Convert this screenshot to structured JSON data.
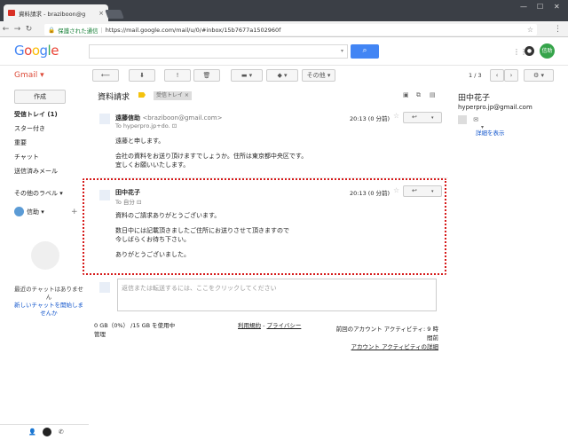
{
  "browser": {
    "tab_title": "資料請求 - braziboon@g",
    "address": {
      "secure_label": "保護された通信",
      "url": "https://mail.google.com/mail/u/0/#inbox/15b7677a1502960f"
    }
  },
  "header": {
    "logo": "Google",
    "avatar_text": "信助"
  },
  "toolbar": {
    "app_label": "Gmail ▾",
    "back_glyph": "⟵",
    "archive_glyph": "⬇",
    "spam_glyph": "!",
    "delete_glyph": "🗑",
    "folder_glyph": "▬ ▾",
    "label_glyph": "◆ ▾",
    "more_label": "その他 ▾",
    "pagination": "1 / 3",
    "settings_glyph": "⚙ ▾"
  },
  "sidebar": {
    "compose_label": "作成",
    "items": [
      {
        "label": "受信トレイ (1)",
        "bold": true
      },
      {
        "label": "スター付き"
      },
      {
        "label": "重要"
      },
      {
        "label": "チャット"
      },
      {
        "label": "送信済みメール"
      },
      {
        "label": "その他のラベル ▾"
      }
    ],
    "chat_user": "信助 ▾",
    "chat_note": "最近のチャットはありません",
    "chat_link": "新しいチャットを開始しませんか"
  },
  "thread": {
    "subject": "資料請求",
    "label_chip": "受信トレイ ×",
    "messages": [
      {
        "sender": "遠藤信助",
        "email": "<braziboon@gmail.com>",
        "to": "To hyperpro.jp+do.",
        "time": "20:13 (0 分前)",
        "body": [
          "遠藤と申します。",
          "",
          "会社の資料をお送り頂けますでしょうか。住所は東京都中央区です。",
          "宜しくお願いいたします。"
        ]
      },
      {
        "sender": "田中花子",
        "email": "",
        "to": "To 自分",
        "time": "20:13 (0 分前)",
        "body": [
          "資料のご請求ありがとうございます。",
          "",
          "数日中には記載頂きましたご住所にお送りさせて頂きますので",
          "今しばらくお待ち下さい。",
          "",
          "ありがとうございました。"
        ]
      }
    ],
    "reply_placeholder": "返信または転送するには、ここをクリックしてください"
  },
  "footer": {
    "storage": "0 GB（0%） /15 GB を使用中",
    "manage": "管理",
    "terms": "利用規約",
    "privacy": "プライバシー",
    "activity": "前回のアカウント アクティビティ: 9 時間前",
    "activity_link": "アカウント アクティビティの詳細"
  },
  "contact": {
    "name": "田中花子",
    "email": "hyperpro.jp@gmail.com",
    "details_link": "詳細を表示"
  },
  "colors": {
    "accent": "#4285f4",
    "gmail_red": "#dd4b39",
    "highlight": "#d61a1a"
  }
}
